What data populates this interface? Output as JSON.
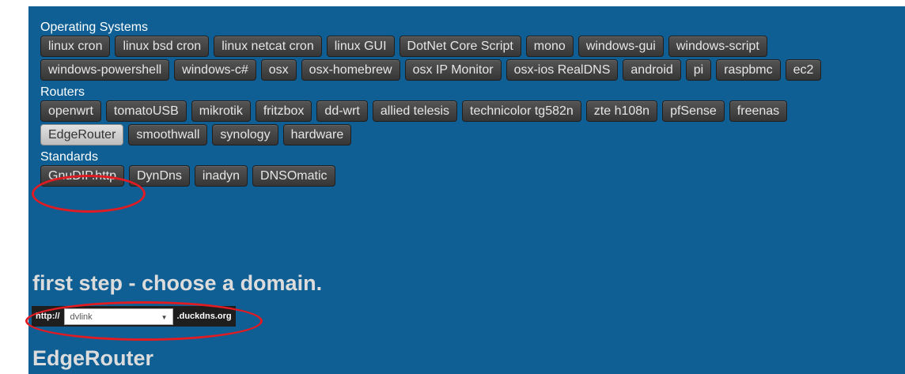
{
  "sections": [
    {
      "title": "Operating Systems",
      "buttons": [
        "linux cron",
        "linux bsd cron",
        "linux netcat cron",
        "linux GUI",
        "DotNet Core Script",
        "mono",
        "windows-gui",
        "windows-script",
        "windows-powershell",
        "windows-c#",
        "osx",
        "osx-homebrew",
        "osx IP Monitor",
        "osx-ios RealDNS",
        "android",
        "pi",
        "raspbmc",
        "ec2"
      ]
    },
    {
      "title": "Routers",
      "buttons": [
        "openwrt",
        "tomatoUSB",
        "mikrotik",
        "fritzbox",
        "dd-wrt",
        "allied telesis",
        "technicolor tg582n",
        "zte h108n",
        "pfSense",
        "freenas",
        "EdgeRouter",
        "smoothwall",
        "synology",
        "hardware"
      ]
    },
    {
      "title": "Standards",
      "buttons": [
        "GnuDIP.http",
        "DynDns",
        "inadyn",
        "DNSOmatic"
      ]
    }
  ],
  "selected_button": "EdgeRouter",
  "step_heading": "first step - choose a domain.",
  "domain": {
    "prefix": "http://",
    "selected": "dvlink",
    "suffix": ".duckdns.org"
  },
  "result_heading": "EdgeRouter",
  "colors": {
    "panel_bg": "#0f5f94",
    "highlight": "#e01b22"
  }
}
